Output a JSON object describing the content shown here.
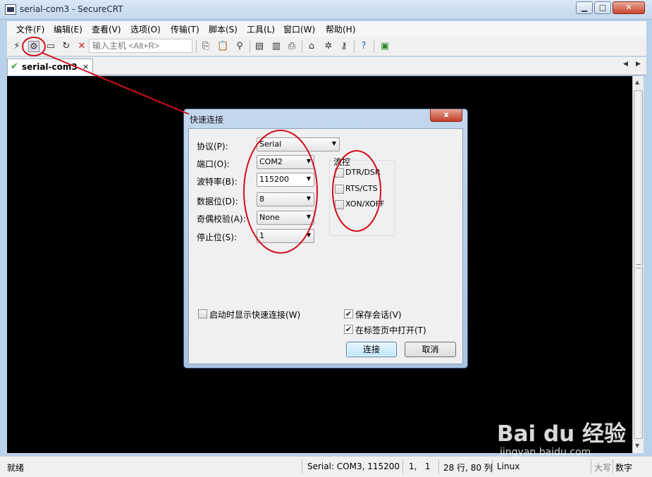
{
  "window": {
    "title": "serial-com3 - SecureCRT"
  },
  "menu": [
    "文件(F)",
    "编辑(E)",
    "查看(V)",
    "选项(O)",
    "传输(T)",
    "脚本(S)",
    "工具(L)",
    "窗口(W)",
    "帮助(H)"
  ],
  "toolbar": {
    "host_placeholder": "输入主机 <Alt+R>"
  },
  "tab": {
    "label": "serial-com3",
    "close": "×"
  },
  "dialog": {
    "title": "快速连接",
    "close": "x",
    "protocol": {
      "label": "协议(P):",
      "value": "Serial"
    },
    "port": {
      "label": "端口(O):",
      "value": "COM2"
    },
    "baud": {
      "label": "波特率(B):",
      "value": "115200"
    },
    "databits": {
      "label": "数据位(D):",
      "value": "8"
    },
    "parity": {
      "label": "奇偶校验(A):",
      "value": "None"
    },
    "stopbits": {
      "label": "停止位(S):",
      "value": "1"
    },
    "flow": {
      "title": "流控",
      "options": [
        {
          "label": "DTR/DSR",
          "checked": false
        },
        {
          "label": "RTS/CTS",
          "checked": false
        },
        {
          "label": "XON/XOFF",
          "checked": false
        }
      ]
    },
    "show_on_start": {
      "label": "启动时显示快速连接(W)",
      "checked": false
    },
    "save_session": {
      "label": "保存会话(V)",
      "checked": true
    },
    "open_in_tab": {
      "label": "在标签页中打开(T)",
      "checked": true
    },
    "connect": "连接",
    "cancel": "取消"
  },
  "status": {
    "ready": "就绪",
    "connection": "Serial: COM3, 115200",
    "cursor": "1,   1",
    "size": "28 行, 80 列",
    "term": "Linux",
    "caps": "大写",
    "num": "数字"
  },
  "watermark": {
    "logo": "Bai du 经验",
    "url": "jingyan.baidu.com"
  }
}
